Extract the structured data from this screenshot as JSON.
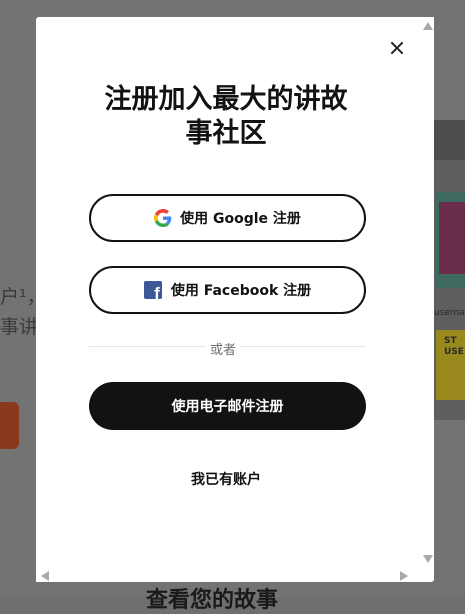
{
  "background": {
    "text_line_1": "户¹，",
    "text_line_2": "事讲",
    "bottom_title": "查看您的故事",
    "panel_label": "usernam",
    "panel_cover_text": "ST\nUSE"
  },
  "modal": {
    "title_line_1": "注册加入最大的讲故",
    "title_line_2": "事社区",
    "google_button": "使用 Google 注册",
    "facebook_button": "使用 Facebook 注册",
    "divider_label": "或者",
    "email_button": "使用电子邮件注册",
    "login_link": "我已有账户"
  },
  "icons": {
    "close": "close-icon",
    "google": "google-icon",
    "facebook": "facebook-icon"
  },
  "colors": {
    "overlay": "#737373",
    "modal_bg": "#ffffff",
    "primary_text": "#121212",
    "email_button_bg": "#121212",
    "facebook_blue": "#3b5998",
    "accent_button": "#8a3a1c"
  }
}
